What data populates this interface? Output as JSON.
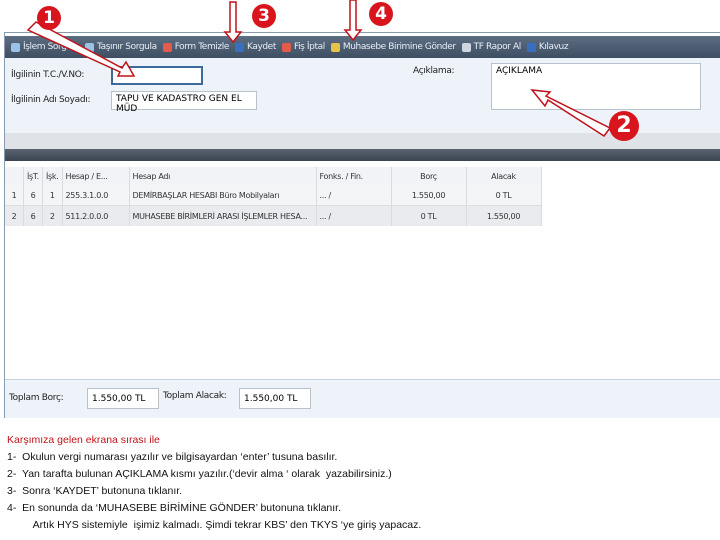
{
  "toolbar": {
    "items": [
      {
        "label": "İşlem Sorgula",
        "icon": "search-icon",
        "color": "#9cc3e6"
      },
      {
        "label": "Taşınır Sorgula",
        "icon": "search-icon",
        "color": "#9cc3e6"
      },
      {
        "label": "Form Temizle",
        "icon": "clear-icon",
        "color": "#e35b4a"
      },
      {
        "label": "Kaydet",
        "icon": "save-icon",
        "color": "#3a6fc0"
      },
      {
        "label": "Fiş İptal",
        "icon": "cancel-icon",
        "color": "#e35b4a"
      },
      {
        "label": "Muhasebe Birimine Gönder",
        "icon": "send-icon",
        "color": "#e8c24a"
      },
      {
        "label": "TF Rapor Al",
        "icon": "print-icon",
        "color": "#d0d6de"
      },
      {
        "label": "Kılavuz",
        "icon": "help-icon",
        "color": "#3a6fc0"
      }
    ]
  },
  "form": {
    "tc_label": "İlgilinin T.C./V.NO:",
    "tc_value": "",
    "name_label": "İlgilinin Adı Soyadı:",
    "name_value": "TAPU VE KADASTRO GEN EL MÜD",
    "desc_label": "Açıklama:",
    "desc_value": "AÇIKLAMA"
  },
  "table": {
    "headers": [
      "",
      "İşT.",
      "İşk.",
      "Hesap / E...",
      "Hesap Adı",
      "Fonks. / Fin.",
      "Borç",
      "Alacak"
    ],
    "rows": [
      [
        "1",
        "6",
        "1",
        "255.3.1.0.0",
        "DEMİRBAŞLAR HESABI   Büro Mobilyaları",
        "... /",
        "1.550,00",
        "0 TL"
      ],
      [
        "2",
        "6",
        "2",
        "511.2.0.0.0",
        "MUHASEBE BİRİMLERİ ARASI İŞLEMLER HESA...",
        "... /",
        "0 TL",
        "1.550,00"
      ]
    ]
  },
  "totals": {
    "debit_label": "Toplam Borç:",
    "debit_value": "1.550,00 TL",
    "credit_label": "Toplam Alacak:",
    "credit_value": "1.550,00 TL"
  },
  "callouts": [
    "1",
    "2",
    "3",
    "4"
  ],
  "notes": {
    "heading": "Karşımıza gelen ekrana sırası ile",
    "lines": [
      "1-  Okulun vergi numarası yazılır ve bilgisayardan ‘enter’ tusuna basılır.",
      "2-  Yan tarafta bulunan AÇIKLAMA kısmı yazılır.(‘devir alma ‘ olarak  yazabilirsiniz.)",
      "3-  Sonra ‘KAYDET’ butonuna tıklanır.",
      "4-  En sonunda da ‘MUHASEBE BİRİMİNE GÖNDER’ butonuna tıklanır.",
      "         Artık HYS sistemiyle  işimiz kalmadı. Şimdi tekrar KBS’ den TKYS ‘ye giriş yapacaz."
    ]
  }
}
